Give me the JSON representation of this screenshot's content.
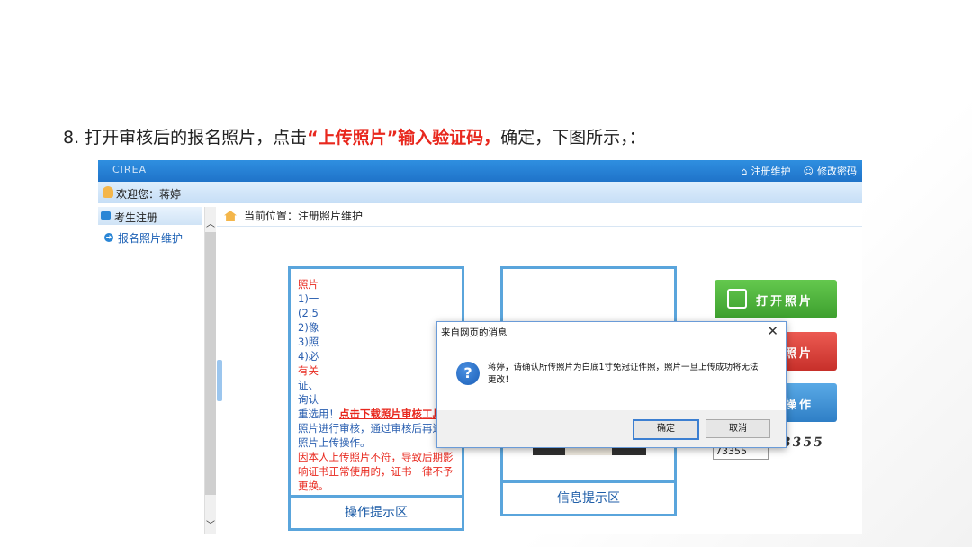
{
  "slide": {
    "caption_prefix": "8. 打开审核后的报名照片，点击",
    "caption_highlight": "“上传照片”输入验证码，",
    "caption_suffix": "确定，下图所示，："
  },
  "app": {
    "brand": "CIREA",
    "top_links": [
      {
        "label": "注册维护",
        "icon": "home-icon"
      },
      {
        "label": "修改密码",
        "icon": "user-icon"
      }
    ],
    "welcome": "欢迎您：蒋婷",
    "breadcrumb": "当前位置：注册照片维护"
  },
  "sidebar": {
    "section": "考生注册",
    "items": [
      {
        "label": "报名照片维护",
        "icon": "arrow-circle-icon"
      }
    ]
  },
  "tips_box": {
    "lines_partial": [
      "照片",
      "1)一",
      "(2.5",
      "2)像",
      "3)照",
      "4)必",
      "有关",
      "证、",
      "询认"
    ],
    "text_before_link": "重选用！",
    "link": "点击下载照片审核工具",
    "text_after_link": "对照片进行审核，通过审核后再进行照片上传操作。",
    "warning": "因本人上传照片不符，导致后期影响证书正常使用的，证书一律不予更换。",
    "footer": "操作提示区"
  },
  "info_box": {
    "footer": "信息提示区"
  },
  "buttons": {
    "open": "打开照片",
    "upload": "上传照片",
    "exit": "退出操作"
  },
  "captcha": {
    "input_value": "73355",
    "image_text": "73355"
  },
  "dialog": {
    "title": "来自网页的消息",
    "icon": "question-icon",
    "message": "蒋婷，请确认所传照片为白底1寸免冠证件照，照片一旦上传成功将无法更改！",
    "ok": "确定",
    "cancel": "取消"
  }
}
